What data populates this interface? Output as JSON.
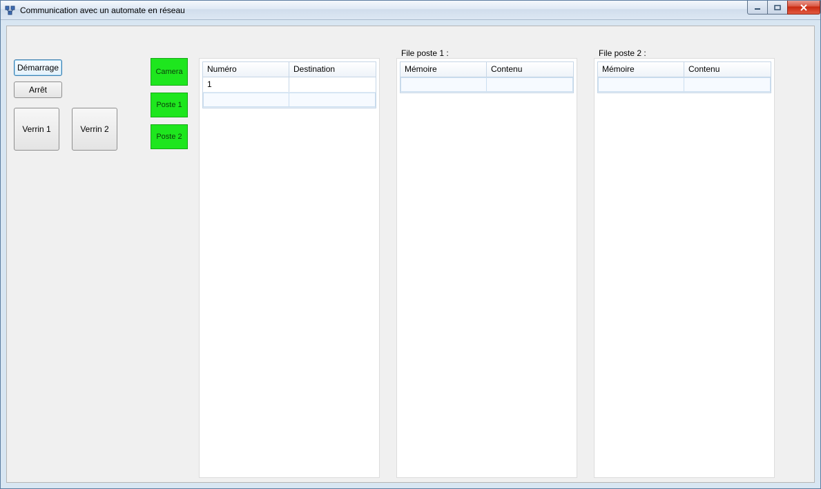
{
  "window": {
    "title": "Communication avec un automate en réseau"
  },
  "controls": {
    "demarrage": "Démarrage",
    "arret": "Arrêt",
    "verrin1": "Verrin 1",
    "verrin2": "Verrin 2"
  },
  "indicators": {
    "camera": "Camera",
    "poste1": "Poste 1",
    "poste2": "Poste 2"
  },
  "grid_main": {
    "col_numero": "Numéro",
    "col_destination": "Destination",
    "rows": [
      {
        "numero": "1",
        "destination": ""
      }
    ]
  },
  "file_poste1": {
    "legend": "File poste 1 :",
    "col_memoire": "Mémoire",
    "col_contenu": "Contenu"
  },
  "file_poste2": {
    "legend": "File poste 2 :",
    "col_memoire": "Mémoire",
    "col_contenu": "Contenu"
  },
  "colors": {
    "indicator_on": "#1ee61e"
  }
}
